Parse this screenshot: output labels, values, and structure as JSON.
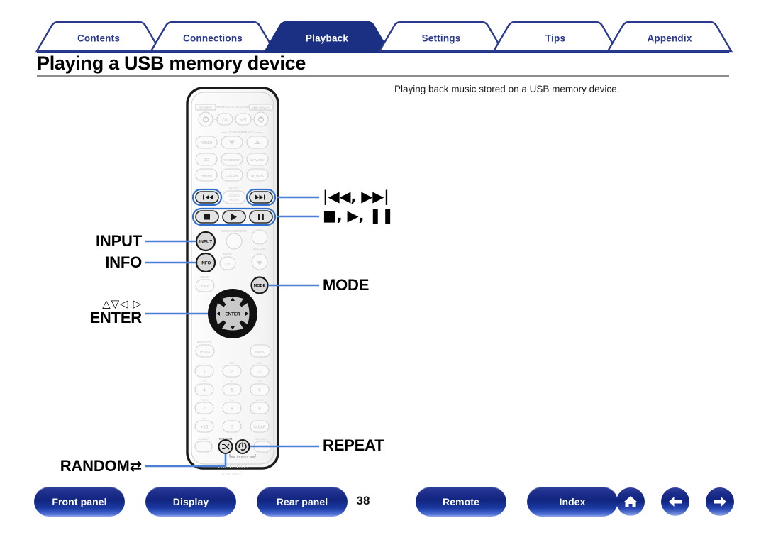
{
  "document": {
    "title": "Playing a USB memory device",
    "page_number": "38"
  },
  "tabs": [
    {
      "label": "Contents",
      "active": false
    },
    {
      "label": "Connections",
      "active": false
    },
    {
      "label": "Playback",
      "active": true
    },
    {
      "label": "Settings",
      "active": false
    },
    {
      "label": "Tips",
      "active": false
    },
    {
      "label": "Appendix",
      "active": false
    }
  ],
  "content": {
    "intro": "Playing back music stored on a USB memory device."
  },
  "callouts": {
    "skip": "ᵚ◀◀, ▶▶ᵚ",
    "skip_text": "|◀◀, ▶▶|",
    "transport_text": "■, ▶, ❚❚",
    "input": "INPUT",
    "info": "INFO",
    "mode": "MODE",
    "cursor_arrows": "△▽◁ ▷",
    "enter": "ENTER",
    "random": "RANDOM",
    "random_icon": "shuffle-icon",
    "repeat": "REPEAT"
  },
  "remote": {
    "brand": "marantz",
    "model": "RC001PMCD",
    "group_labels": {
      "power": "POWER",
      "remote_mode": "REMOTE MODE",
      "amp_power": "AMP POWER",
      "tuner_preset": "TUNER PRESET",
      "m_dax": "M-DAX",
      "source_direct": "SOURCE DIRECT",
      "volume": "VOLUME",
      "mute": "MUTE",
      "home": "HOME",
      "favorite": "FAVORITE",
      "dimmer": "DIMMER",
      "random": "RANDOM",
      "search": "SEARCH",
      "repeat": "REPEAT"
    },
    "buttons": {
      "cd": "CD",
      "net": "NET",
      "tuner": "TUNER",
      "recorder": "RECORDER",
      "network": "NETWORK",
      "phono": "PHONO",
      "coaxial": "COAXIAL",
      "optical": "OPTICAL",
      "sound_mode": "SOUND MODE",
      "input": "INPUT",
      "info": "INFO",
      "mode": "MODE",
      "time": "TIME",
      "enter": "ENTER",
      "prog": "PROG",
      "menu": "MENU",
      "clear": "CLEAR",
      "plus_ten": "+10"
    },
    "keypad": [
      "1",
      "2",
      "3",
      "4",
      "5",
      "6",
      "7",
      "8",
      "9",
      "+10",
      "0",
      "CLEAR"
    ],
    "keypad_letters": [
      "",
      "ABC",
      "DEF",
      "GHI",
      "JKL",
      "MNO",
      "PQRS",
      "TUV",
      "WXYZ",
      "@/:",
      "_"
    ]
  },
  "bottom_bar": {
    "buttons": [
      {
        "label": "Front panel"
      },
      {
        "label": "Display"
      },
      {
        "label": "Rear panel"
      },
      {
        "label": "Remote"
      },
      {
        "label": "Index"
      }
    ],
    "icons": [
      {
        "name": "home-icon"
      },
      {
        "name": "back-arrow-icon"
      },
      {
        "name": "forward-arrow-icon"
      }
    ]
  },
  "colors": {
    "tab_blue": "#2a3b8f",
    "tab_active_fill": "#1b3083",
    "accent_line": "#4a7fd4",
    "rule_gray": "#8d8d8d"
  }
}
